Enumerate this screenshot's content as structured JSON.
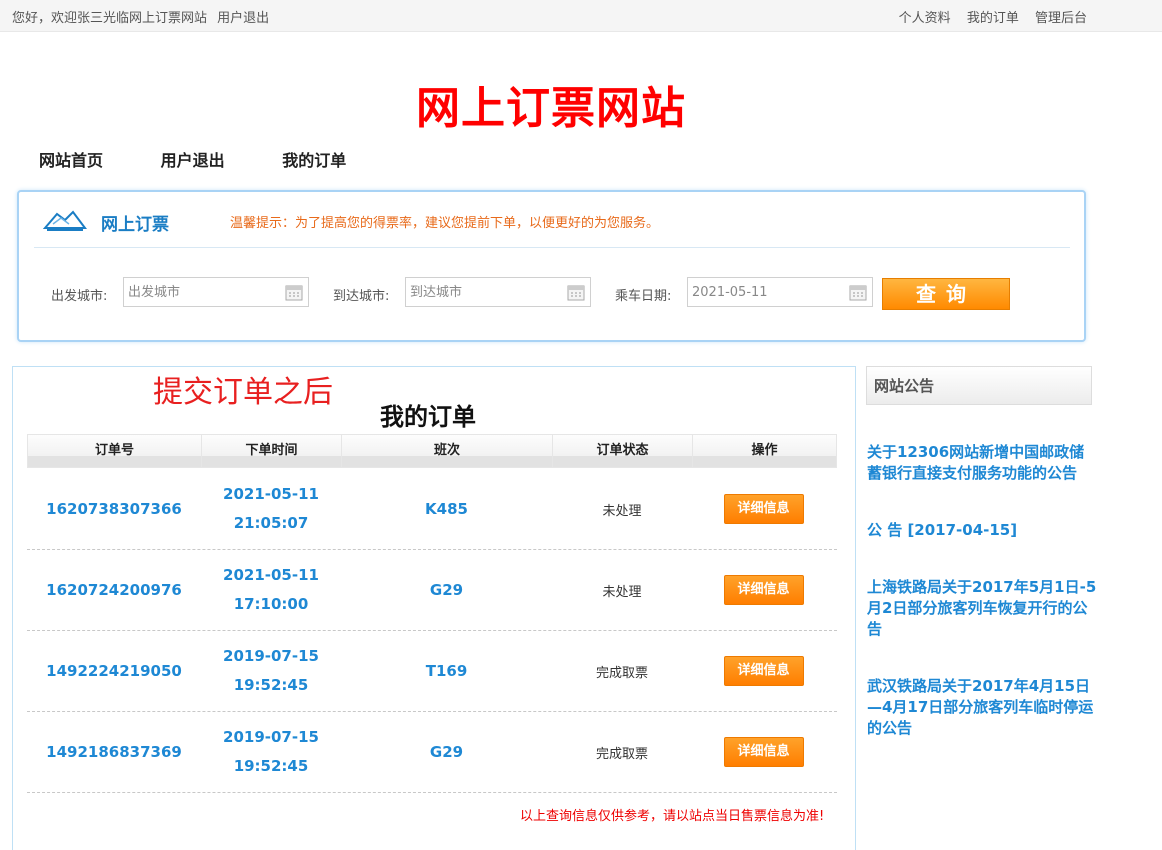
{
  "topbar": {
    "welcome": "您好，欢迎张三光临网上订票网站",
    "logout": "用户退出",
    "links": [
      "个人资料",
      "我的订单",
      "管理后台"
    ]
  },
  "site_title": "网上订票网站",
  "nav": [
    "网站首页",
    "用户退出",
    "我的订单"
  ],
  "search": {
    "title": "网上订票",
    "tip": "温馨提示：为了提高您的得票率，建议您提前下单，以便更好的为您服务。",
    "from_label": "出发城市:",
    "from_placeholder": "出发城市",
    "to_label": "到达城市:",
    "to_placeholder": "到达城市",
    "date_label": "乘车日期:",
    "date_value": "2021-05-11",
    "query_button": "查询"
  },
  "annotation": "提交订单之后",
  "orders": {
    "title": "我的订单",
    "columns": [
      "订单号",
      "下单时间",
      "班次",
      "订单状态",
      "操作"
    ],
    "rows": [
      {
        "id": "1620738307366",
        "date": "2021-05-11",
        "time": "21:05:07",
        "train": "K485",
        "status": "未处理",
        "action": "详细信息"
      },
      {
        "id": "1620724200976",
        "date": "2021-05-11",
        "time": "17:10:00",
        "train": "G29",
        "status": "未处理",
        "action": "详细信息"
      },
      {
        "id": "1492224219050",
        "date": "2019-07-15",
        "time": "19:52:45",
        "train": "T169",
        "status": "完成取票",
        "action": "详细信息"
      },
      {
        "id": "1492186837369",
        "date": "2019-07-15",
        "time": "19:52:45",
        "train": "G29",
        "status": "完成取票",
        "action": "详细信息"
      }
    ],
    "disclaimer": "以上查询信息仅供参考，请以站点当日售票信息为准!"
  },
  "notices": {
    "title": "网站公告",
    "items": [
      "关于12306网站新增中国邮政储蓄银行直接支付服务功能的公告",
      "公 告 [2017-04-15]",
      "上海铁路局关于2017年5月1日-5月2日部分旅客列车恢复开行的公告",
      "武汉铁路局关于2017年4月15日—4月17日部分旅客列车临时停运的公告"
    ]
  },
  "colors": {
    "accent_blue": "#1e88d4",
    "title_red": "#ff0000",
    "button_orange": "#ff8a00",
    "tip_orange": "#e86a1a"
  }
}
